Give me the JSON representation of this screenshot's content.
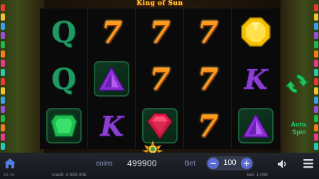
{
  "game": {
    "title": "King of Sun",
    "reels": [
      [
        "Q",
        "Q",
        "green-gem"
      ],
      [
        "7",
        "purple-gem",
        "K"
      ],
      [
        "7",
        "7",
        "red-gem"
      ],
      [
        "7",
        "7",
        "7"
      ],
      [
        "yellow-gem",
        "K",
        "purple-gem"
      ]
    ],
    "auto_spin_label_1": "Auto.",
    "auto_spin_label_2": "Spin"
  },
  "bottom_bar": {
    "coins_label": "coins",
    "coins_value": "499900",
    "bet_label": "Bet",
    "bet_value": "100",
    "minus_label": "−",
    "plus_label": "+",
    "clock": "19:39",
    "credit_text": "credit: 4 999,00€",
    "bet_text": "bet: 1,00€"
  },
  "colors": {
    "accent_green": "#26d06a",
    "bet_button": "#5a6bd6",
    "title_gold": "#ffcf3a"
  }
}
